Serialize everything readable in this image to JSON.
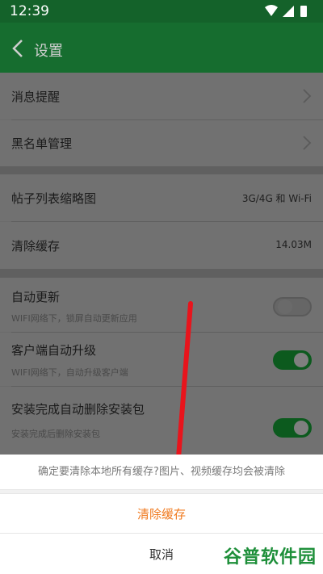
{
  "status_bar": {
    "time": "12:39"
  },
  "app_bar": {
    "title": "设置"
  },
  "settings": {
    "notifications": "消息提醒",
    "blacklist": "黑名单管理",
    "thumbnail_label": "帖子列表缩略图",
    "thumbnail_value": "3G/4G 和 Wi-Fi",
    "clear_cache_label": "清除缓存",
    "cache_size": "14.03M",
    "auto_update_label": "自动更新",
    "auto_update_sub": "WIFI网络下，锁屏自动更新应用",
    "auto_update_on": false,
    "client_upgrade_label": "客户端自动升级",
    "client_upgrade_sub": "WIFI网络下，自动升级客户端",
    "client_upgrade_on": true,
    "delete_pkg_label": "安装完成自动删除安装包",
    "delete_pkg_sub": "安装完成后删除安装包",
    "delete_pkg_on": true
  },
  "dialog": {
    "message": "确定要清除本地所有缓存?图片、视频缓存均会被清除",
    "confirm": "清除缓存",
    "cancel": "取消"
  },
  "watermark": {
    "text": "谷普软件园"
  },
  "colors": {
    "accent": "#f07a1f",
    "brand": "#166d2f",
    "toggle_on": "#0c5a1e",
    "arrow": "#e8141c"
  }
}
